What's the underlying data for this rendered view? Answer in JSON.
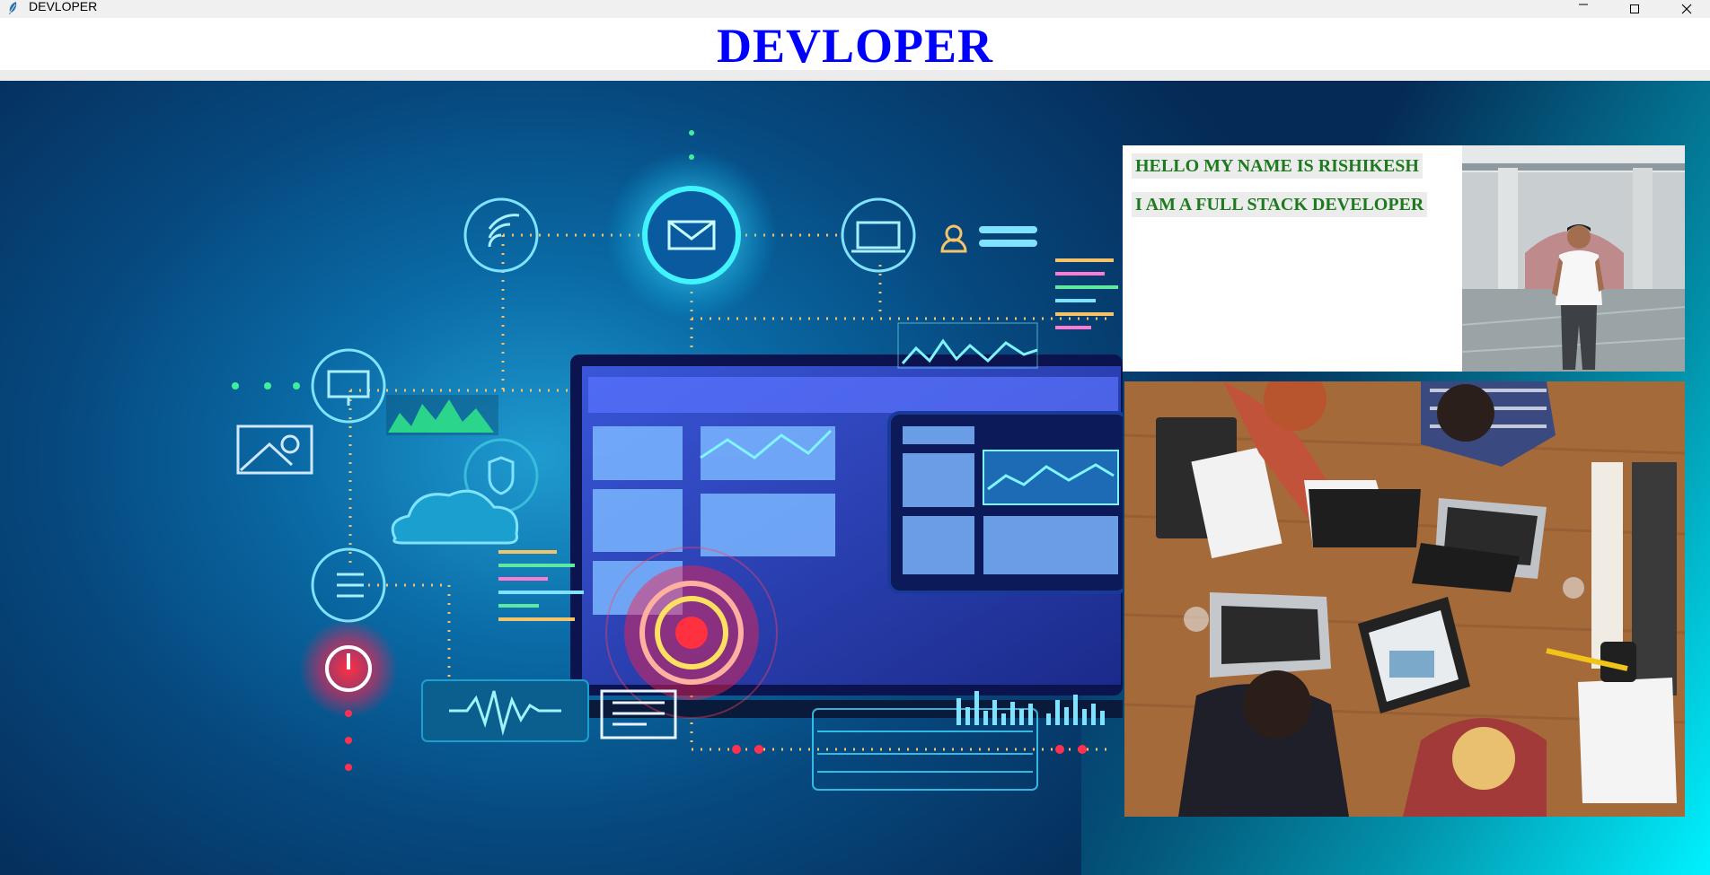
{
  "window": {
    "title": "DEVLOPER",
    "controls": [
      "minimize-icon",
      "maximize-icon",
      "close-icon"
    ]
  },
  "header": {
    "title": "DEVLOPER",
    "title_color": "#0000ff"
  },
  "intro": {
    "line1": "HELLO MY NAME IS RISHIKESH",
    "line2": "I AM A FULL STACK DEVELOPER",
    "text_color": "#1e7a1e"
  },
  "images": {
    "hero": "technology-illustration",
    "profile": "profile-photo",
    "team": "team-at-desk-photo"
  }
}
